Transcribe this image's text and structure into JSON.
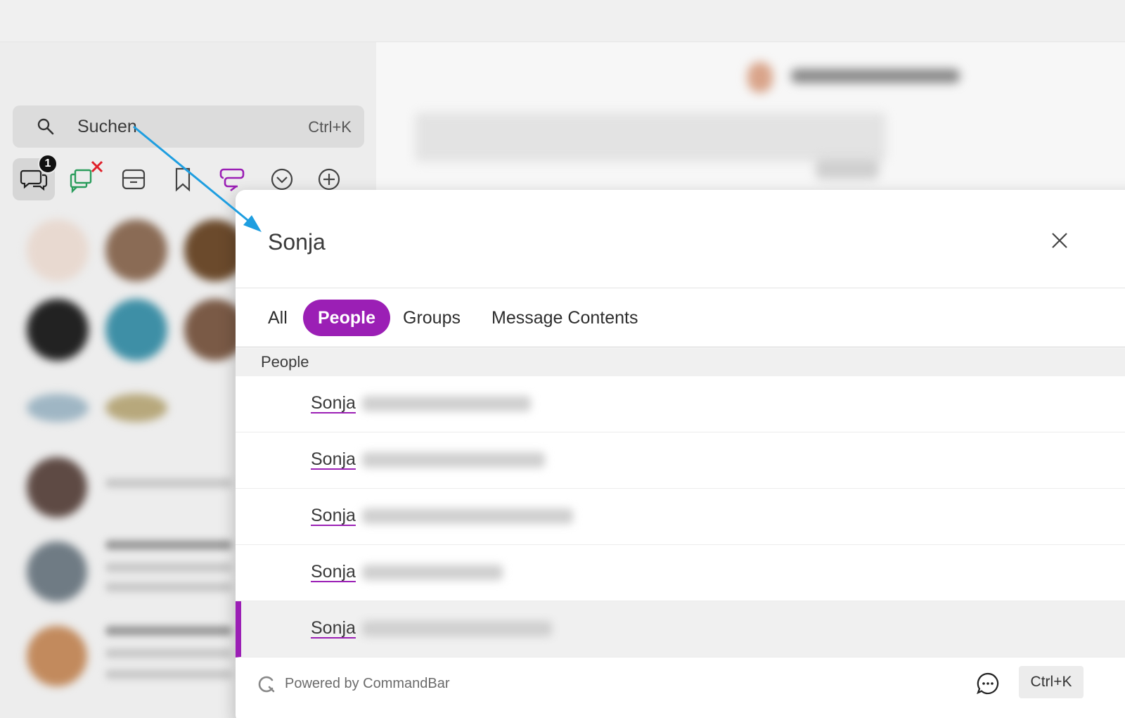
{
  "sidebar": {
    "search": {
      "placeholder": "Suchen",
      "shortcut": "Ctrl+K"
    },
    "toolbar_icons": [
      "compose-icon",
      "settings-icon",
      "notifications-icon"
    ],
    "tabs": [
      {
        "icon": "chats-icon",
        "badge": "1",
        "selected": true
      },
      {
        "icon": "disconnected-chats-icon"
      },
      {
        "icon": "archive-icon"
      },
      {
        "icon": "bookmark-icon"
      },
      {
        "icon": "spaces-icon",
        "color": "#9b1fb5"
      },
      {
        "icon": "chevron-down-circle-icon"
      },
      {
        "icon": "add-circle-icon"
      }
    ]
  },
  "palette": {
    "query": "Sonja",
    "filters": [
      {
        "label": "All",
        "active": false
      },
      {
        "label": "People",
        "active": true
      },
      {
        "label": "Groups",
        "active": false
      },
      {
        "label": "Message Contents",
        "active": false
      }
    ],
    "section_title": "People",
    "results": [
      {
        "name": "Sonja"
      },
      {
        "name": "Sonja"
      },
      {
        "name": "Sonja"
      },
      {
        "name": "Sonja"
      },
      {
        "name": "Sonja",
        "selected": true
      }
    ],
    "footer": {
      "powered_by": "Powered by CommandBar",
      "shortcut": "Ctrl+K"
    }
  },
  "colors": {
    "accent": "#9b1fb5",
    "arrow": "#1e9ee0",
    "error": "#e0202a",
    "green": "#2a9d5c"
  }
}
